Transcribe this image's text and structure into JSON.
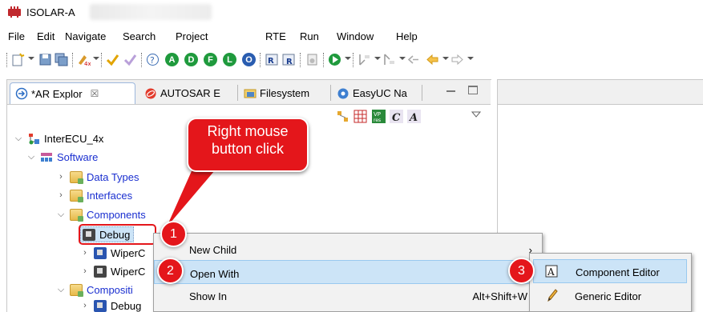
{
  "window": {
    "title": "ISOLAR-A"
  },
  "menubar": {
    "items": [
      "File",
      "Edit",
      "Navigate",
      "Search",
      "Project",
      "RTE",
      "Run",
      "Window",
      "Help"
    ]
  },
  "tabs": [
    {
      "label": "*AR Explor",
      "close": "☒"
    },
    {
      "label": "AUTOSAR E"
    },
    {
      "label": "Filesystem"
    },
    {
      "label": "EasyUC Na"
    }
  ],
  "toolbar": {
    "round_buttons": [
      "A",
      "D",
      "F",
      "L",
      "O"
    ]
  },
  "tree": {
    "root": "InterECU_4x",
    "software": "Software",
    "data_types": "Data Types",
    "interfaces": "Interfaces",
    "components": "Components",
    "debug": "Debug",
    "wiper1": "WiperC",
    "wiper2": "WiperC",
    "compositions": "Compositi",
    "debug2": "Debug"
  },
  "callout": {
    "text": "Right mouse button click",
    "badges": [
      "1",
      "2",
      "3"
    ]
  },
  "context_menu": {
    "new_child": "New Child",
    "open_with": "Open With",
    "show_in": "Show In",
    "show_in_shortcut": "Alt+Shift+W",
    "arrow": "›"
  },
  "submenu": {
    "component_editor": "Component Editor",
    "generic_editor": "Generic Editor"
  },
  "colors": {
    "callout": "#e4161b",
    "link": "#1a2fd0",
    "selection": "#cce4f7"
  }
}
